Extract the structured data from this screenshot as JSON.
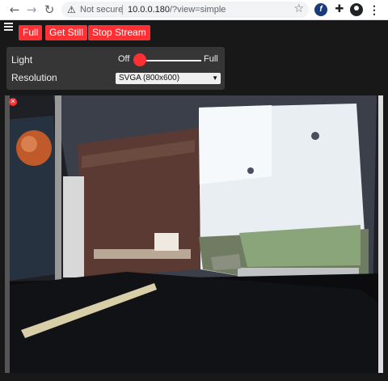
{
  "browser": {
    "url_security": "Not secure",
    "url_host": "10.0.0.180",
    "url_path": "/?view=simple",
    "icons": [
      "back-arrow-icon",
      "forward-arrow-icon",
      "reload-icon",
      "warning-icon",
      "star-icon",
      "extension-icon",
      "puzzle-icon",
      "profile-icon",
      "menu-icon"
    ]
  },
  "toolbar": {
    "menu_icon": "hamburger-icon",
    "buttons": [
      "Full",
      "Get Still",
      "Stop Stream"
    ],
    "accent_color": "#ff3034"
  },
  "settings": {
    "light_label": "Light",
    "light_min_label": "Off",
    "light_max_label": "Full",
    "light_level": 0,
    "resolution_label": "Resolution",
    "resolution_value": "SVGA (800x600)"
  },
  "stream": {
    "close_icon": "close-icon"
  }
}
